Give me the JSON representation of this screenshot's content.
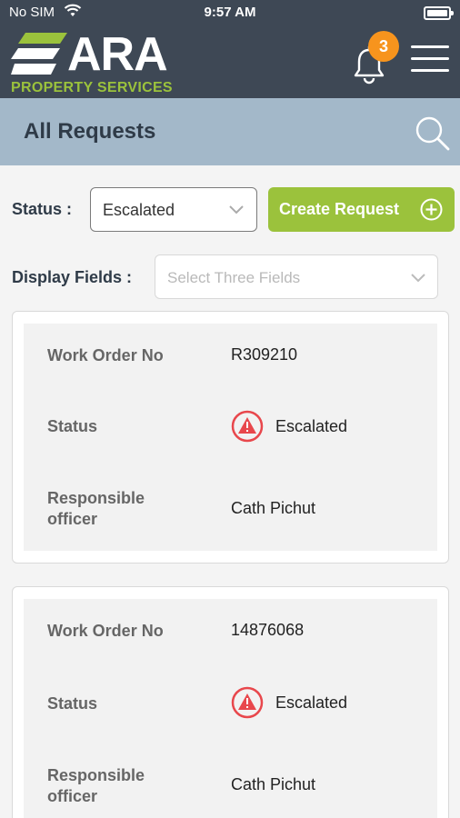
{
  "status_bar": {
    "carrier": "No SIM",
    "time": "9:57 AM"
  },
  "header": {
    "logo_main": "ARA",
    "logo_sub": "PROPERTY SERVICES",
    "notification_count": "3"
  },
  "page": {
    "title": "All Requests"
  },
  "filters": {
    "status_label": "Status :",
    "status_value": "Escalated",
    "create_label": "Create Request",
    "display_label": "Display Fields :",
    "display_placeholder": "Select Three Fields"
  },
  "requests": [
    {
      "work_order_label": "Work Order No",
      "work_order": "R309210",
      "status_label": "Status",
      "status": "Escalated",
      "officer_label_1": "Responsible",
      "officer_label_2": "officer",
      "officer": "Cath Pichut"
    },
    {
      "work_order_label": "Work Order No",
      "work_order": "14876068",
      "status_label": "Status",
      "status": "Escalated",
      "officer_label_1": "Responsible",
      "officer_label_2": "officer",
      "officer": "Cath Pichut"
    }
  ],
  "colors": {
    "header_bg": "#3e4855",
    "titlebar_bg": "#a3b8c9",
    "accent_green": "#9bc23c",
    "badge_orange": "#f7941d",
    "escalated_red": "#e8474c"
  }
}
